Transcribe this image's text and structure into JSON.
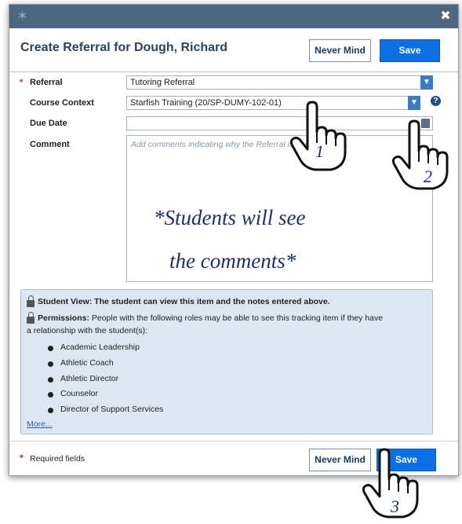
{
  "dialog": {
    "title": "Create Referral for Dough, Richard",
    "close_glyph": "✖",
    "logo_glyph": "✶",
    "buttons": {
      "never_mind": "Never Mind",
      "save": "Save"
    }
  },
  "form": {
    "referral": {
      "label": "Referral",
      "value": "Tutoring Referral",
      "required": true
    },
    "course_context": {
      "label": "Course Context",
      "value": "Starfish Training (20/SP-DUMY-102-01)",
      "help_icon": "?"
    },
    "due_date": {
      "label": "Due Date",
      "value": "",
      "icon": "calendar-icon"
    },
    "comment": {
      "label": "Comment",
      "placeholder": "Add comments indicating why the Referral is being created."
    }
  },
  "info": {
    "student_view_label": "Student View:",
    "student_view_text": "The student can view this item and the notes entered above.",
    "permissions_label": "Permissions:",
    "permissions_text_line1": "People with the following roles may be able to see this tracking item if they have",
    "permissions_text_line2": "a relationship with the student(s):",
    "roles": [
      "Academic Leadership",
      "Athletic Coach",
      "Athletic Director",
      "Counselor",
      "Director of Support Services"
    ],
    "more_link": "More..."
  },
  "footer": {
    "required_star": "*",
    "required_text": "Required fields",
    "never_mind": "Never Mind",
    "save": "Save"
  },
  "overlay": {
    "note_line1": "*Students will see",
    "note_line2": "the comments*",
    "steps": [
      "1",
      "2",
      "3"
    ]
  },
  "colors": {
    "titlebar": "#4d6781",
    "primary_button": "#0c6fe3",
    "info_panel": "#dbe7f3",
    "required": "#c0282d",
    "annotation": "#1f2e6a"
  }
}
